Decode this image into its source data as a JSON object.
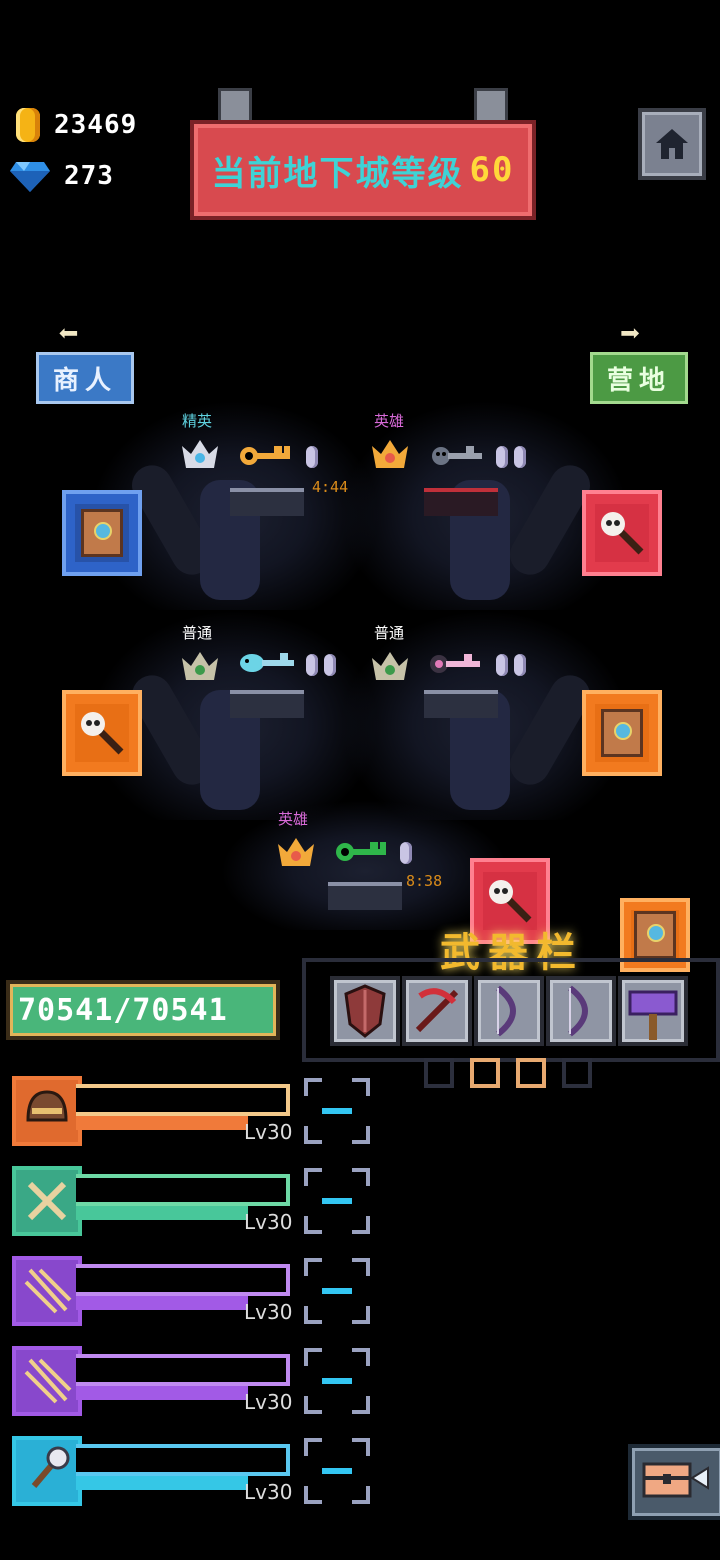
{
  "currency": {
    "gold": "23469",
    "gems": "273"
  },
  "banner": {
    "text": "当前地下城等级",
    "level": "60"
  },
  "nav": {
    "merchant_label": "商人",
    "camp_label": "营地"
  },
  "chambers": [
    {
      "tier": "精英",
      "tier_color": "#5fd2e0",
      "timer": "4:44"
    },
    {
      "tier": "英雄",
      "tier_color": "#d86ad8",
      "timer": ""
    },
    {
      "tier": "普通",
      "tier_color": "#ffffff",
      "timer": ""
    },
    {
      "tier": "普通",
      "tier_color": "#ffffff",
      "timer": ""
    },
    {
      "tier": "英雄",
      "tier_color": "#d86ad8",
      "timer": "8:38"
    }
  ],
  "player": {
    "hp_text": "70541/70541"
  },
  "weapon_bar": {
    "label": "武器栏",
    "active_dots": 2
  },
  "heroes": [
    {
      "level": "Lv30",
      "color": "#f07a3a",
      "icon": "helmet-icon"
    },
    {
      "level": "Lv30",
      "color": "#48c79a",
      "icon": "crossed-bones-icon"
    },
    {
      "level": "Lv30",
      "color": "#a25ae6",
      "icon": "arrows-icon"
    },
    {
      "level": "Lv30",
      "color": "#a25ae6",
      "icon": "arrows-icon"
    },
    {
      "level": "Lv30",
      "color": "#35c7e6",
      "icon": "mace-icon"
    }
  ]
}
